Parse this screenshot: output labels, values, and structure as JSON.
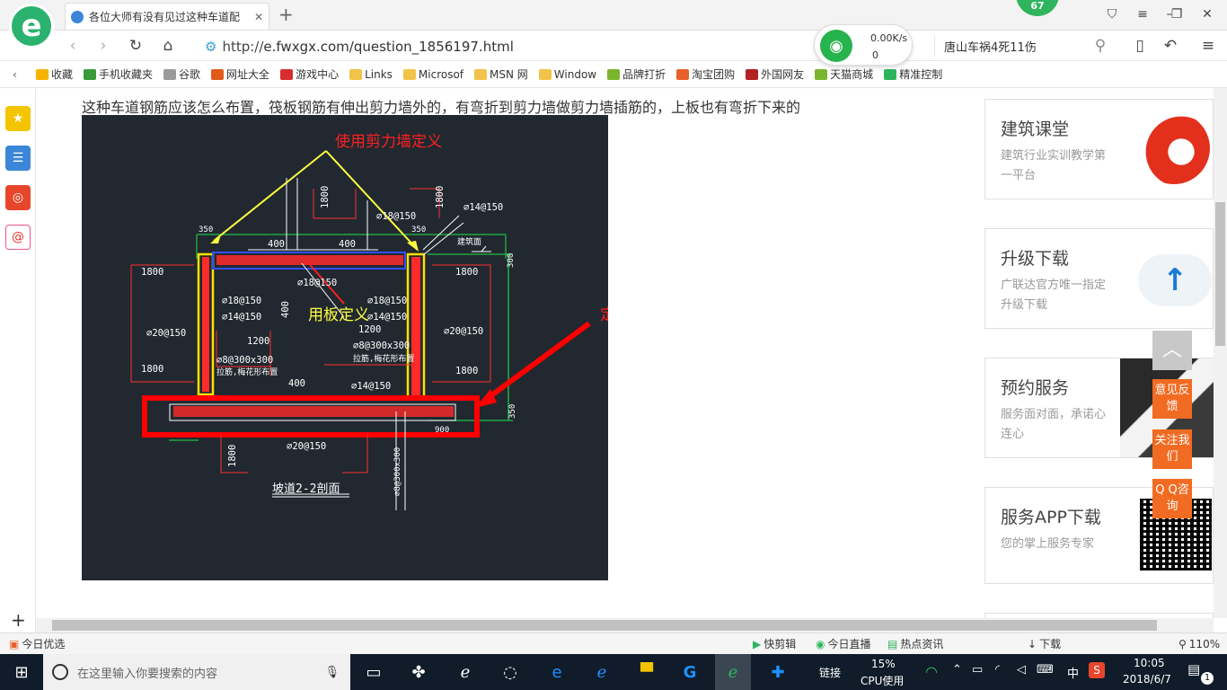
{
  "browser": {
    "tab_title": "各位大师有没有见过这种车道配",
    "badge": "67",
    "url_protocol": "http://",
    "url_rest": "e.fwxgx.com/question_1856197.html",
    "speed": "0.00K/s",
    "speed_count": "0",
    "search_text": "唐山车祸4死11伤"
  },
  "bookmarks": [
    {
      "label": "收藏",
      "color": "#f5b400"
    },
    {
      "label": "手机收藏夹",
      "color": "#3a9a3a"
    },
    {
      "label": "谷歌",
      "color": "#999999"
    },
    {
      "label": "网址大全",
      "color": "#e05a1a"
    },
    {
      "label": "游戏中心",
      "color": "#d62e2e"
    },
    {
      "label": "Links",
      "color": "#f2c34a"
    },
    {
      "label": "Microsof",
      "color": "#f2c34a"
    },
    {
      "label": "MSN 网",
      "color": "#f2c34a"
    },
    {
      "label": "Window",
      "color": "#f2c34a"
    },
    {
      "label": "品牌打折",
      "color": "#7ab52d"
    },
    {
      "label": "淘宝团购",
      "color": "#e8602c"
    },
    {
      "label": "外国网友",
      "color": "#b22222"
    },
    {
      "label": "天猫商城",
      "color": "#7ab52d"
    },
    {
      "label": "精准控制",
      "color": "#2eb45c"
    }
  ],
  "question": "这种车道钢筋应该怎么布置，筏板钢筋有伸出剪力墙外的，有弯折到剪力墙做剪力墙插筋的，上板也有弯折下来的",
  "cad": {
    "annot_wall": "使用剪力墙定义",
    "annot_slab": "用板定义",
    "annot_raft": "定义筏板",
    "title": "坡道2-2剖面",
    "labels": {
      "l1800a": "1800",
      "l1800b": "1800",
      "l1800c": "1800",
      "l1800d": "1800",
      "l1800e": "1800",
      "l1800f": "1800",
      "l1800g": "1800",
      "l350a": "350",
      "l350b": "350",
      "l400a": "400",
      "l400b": "400",
      "l400c": "400",
      "r14_150a": "⌀14@150",
      "r18_150a": "⌀18@150",
      "r18_150b": "⌀18@150",
      "r18_150c": "⌀18@150",
      "r18_150d": "⌀18@150",
      "r14_150b": "⌀14@150",
      "r14_150c": "⌀14@150",
      "r14_150d": "⌀14@150",
      "r20_150a": "⌀20@150",
      "r20_150b": "⌀20@150",
      "r20_150c": "⌀20@150",
      "l1200a": "1200",
      "l1200b": "1200",
      "r8a": "⌀8@300x300",
      "r8b": "⌀8@300x300",
      "r8c": "⌀8@300x300",
      "tie1": "拉筋,梅花形布置",
      "tie2": "拉筋,梅花形布置",
      "l300": "300",
      "l350c": "350",
      "l900": "900",
      "floor": "建筑面"
    }
  },
  "sidecards": [
    {
      "title": "建筑课堂",
      "desc": "建筑行业实训教学第一平台"
    },
    {
      "title": "升级下载",
      "desc": "广联达官方唯一指定升级下载"
    },
    {
      "title": "预约服务",
      "desc": "服务面对面，承诺心连心"
    },
    {
      "title": "服务APP下载",
      "desc": "您的掌上服务专家"
    }
  ],
  "floatbtns": {
    "feedback": "意见反馈",
    "follow": "关注我们",
    "qq": "Q Q咨询"
  },
  "statusbar": {
    "left": "今日优选",
    "items": [
      "快剪辑",
      "今日直播",
      "热点资讯",
      "下载"
    ],
    "zoom": "110%"
  },
  "taskbar": {
    "search_placeholder": "在这里输入你要搜索的内容",
    "link": "链接",
    "cpu_pct": "15%",
    "cpu_label": "CPU使用",
    "ime": "中",
    "time": "10:05",
    "date": "2018/6/7",
    "notif": "1"
  }
}
